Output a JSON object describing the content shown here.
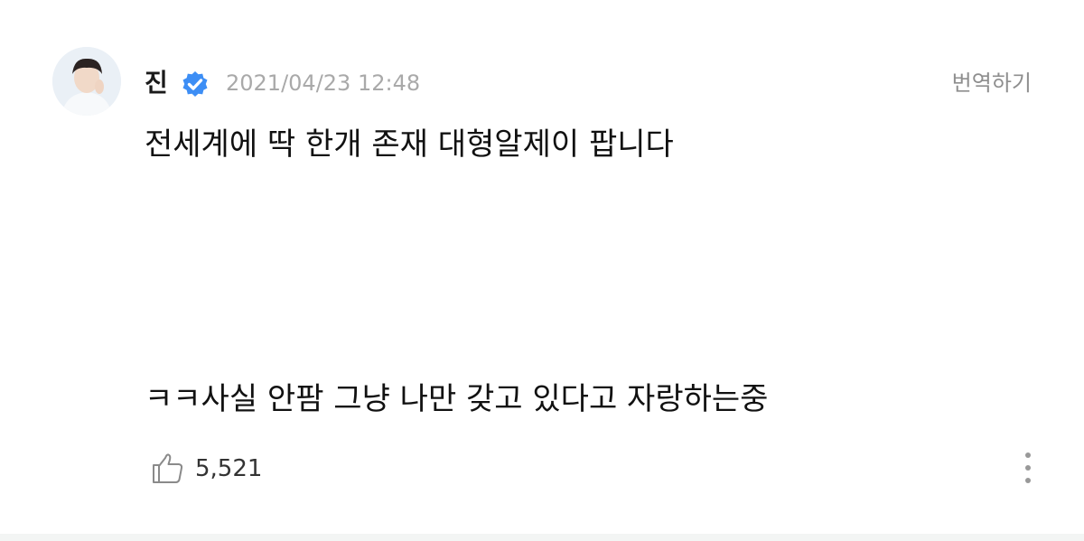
{
  "post": {
    "author": "진",
    "verified": true,
    "timestamp": "2021/04/23 12:48",
    "translate_label": "번역하기",
    "lines": [
      "전세계에 딱 한개 존재 대형알제이 팝니다",
      "ㅋㅋ사실 안팜 그냥 나만 갖고 있다고 자랑하는중"
    ],
    "like_count": "5,521"
  },
  "icons": {
    "avatar": "profile-photo",
    "verified": "verified-badge-icon",
    "like": "thumbs-up-icon",
    "more": "more-vertical-icon"
  },
  "colors": {
    "verified_badge": "#3d8ef5",
    "timestamp": "#a9a9a9",
    "text": "#111111"
  }
}
